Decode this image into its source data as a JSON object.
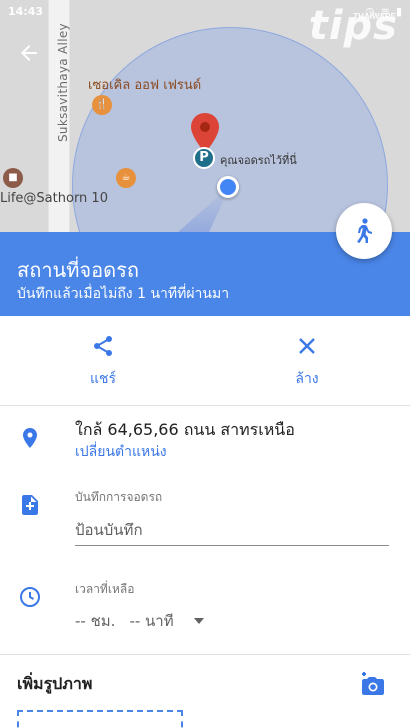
{
  "status_bar": {
    "time": "14:43"
  },
  "watermark": {
    "text": "tips",
    "brand": "THAIWARE"
  },
  "map": {
    "road_label": "Suksavithaya Alley",
    "poi_restaurant_label": "เซอเคิล ออฟ เฟรนด์",
    "poi_life_label": "Life@Sathorn 10",
    "parking_marker_label": "คุณจอดรถไว้ที่นี่",
    "parking_badge": "P"
  },
  "header": {
    "title": "สถานที่จอดรถ",
    "subtitle": "บันทึกแล้วเมื่อไม่ถึง 1 นาทีที่ผ่านมา"
  },
  "actions": {
    "share_label": "แชร์",
    "clear_label": "ล้าง"
  },
  "location": {
    "address": "ใกล้ 64,65,66 ถนน สาทรเหนือ",
    "change_label": "เปลี่ยนตำแหน่ง"
  },
  "notes": {
    "label": "บันทึกการจอดรถ",
    "placeholder": "ป้อนบันทึก"
  },
  "time_left": {
    "label": "เวลาที่เหลือ",
    "hours": "-- ชม.",
    "minutes": "-- นาที"
  },
  "photos": {
    "title": "เพิ่มรูปภาพ"
  },
  "colors": {
    "accent": "#4a86e8",
    "link": "#3b78e7",
    "pin": "#db4437"
  }
}
